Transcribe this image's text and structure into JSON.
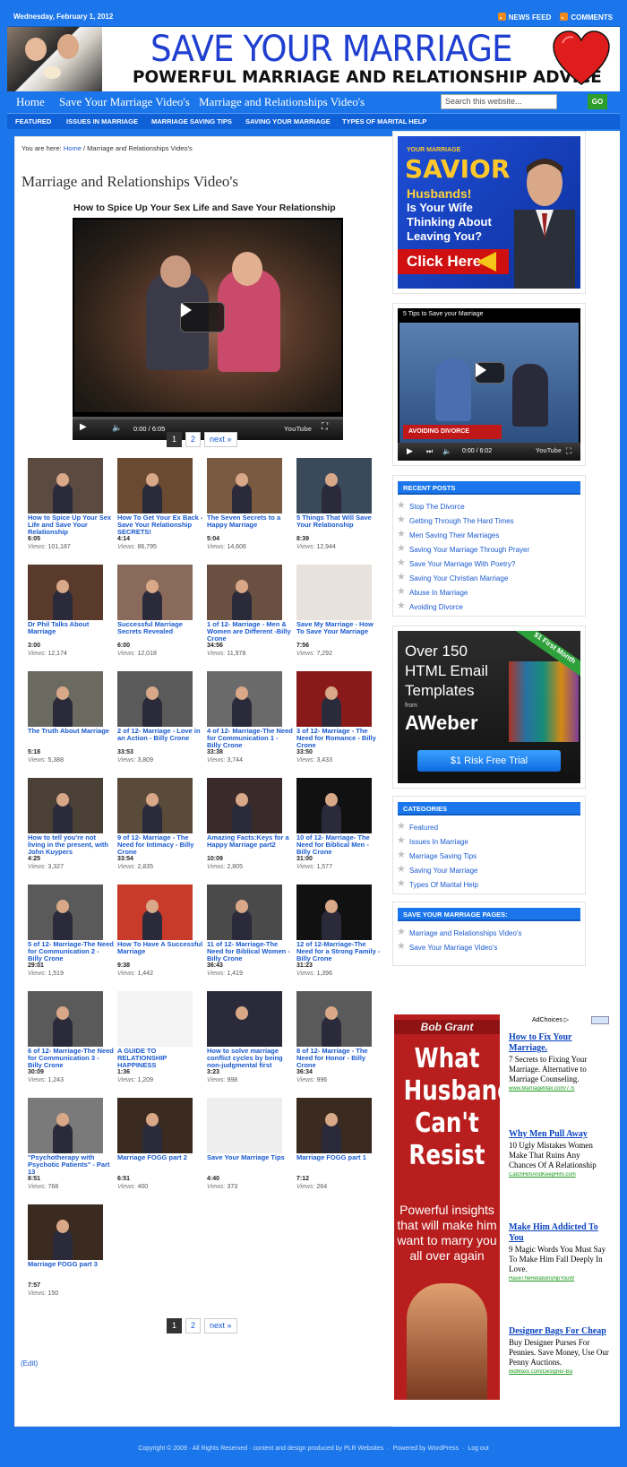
{
  "topbar": {
    "date": "Wednesday, February 1, 2012",
    "news_feed": "NEWS FEED",
    "comments": "COMMENTS"
  },
  "header": {
    "title": "SAVE YOUR MARRIAGE",
    "subtitle": "POWERFUL MARRIAGE AND RELATIONSHIP ADVICE"
  },
  "nav": {
    "primary": [
      "Home",
      "Save Your Marriage Video's",
      "Marriage and Relationships Video's"
    ],
    "search_placeholder": "Search this website...",
    "go": "GO",
    "secondary": [
      "FEATURED",
      "ISSUES IN MARRIAGE",
      "MARRIAGE SAVING TIPS",
      "SAVING YOUR MARRIAGE",
      "TYPES OF MARITAL HELP"
    ]
  },
  "breadcrumb": {
    "prefix": "You are here:",
    "home": "Home",
    "sep": "/",
    "current": "Marriage and Relationships Video's"
  },
  "page": {
    "title": "Marriage and Relationships Video's",
    "video_title": "How to Spice Up Your Sex Life and Save Your Relationship",
    "player_time": "0:00 / 6:05",
    "player_brand": "YouTube",
    "pager": [
      "1",
      "2",
      "next »"
    ],
    "views_label": "Views:",
    "edit": "(Edit)"
  },
  "videos": [
    {
      "title": "How to Spice Up Your Sex Life and Save Your Relationship",
      "dur": "6:05",
      "views": "101,187",
      "col": "#5a4a40"
    },
    {
      "title": "How To Get Your Ex Back - Save Your Relationship SECRETS!",
      "dur": "4:14",
      "views": "86,795",
      "col": "#6a4a30"
    },
    {
      "title": "The Seven Secrets to a Happy Marriage",
      "dur": "5:04",
      "views": "14,606",
      "col": "#7a5a40"
    },
    {
      "title": "5 Things That Will Save Your Relationship",
      "dur": "8:39",
      "views": "12,944",
      "col": "#3a4a5a"
    },
    {
      "title": "Dr Phil Talks About Marriage",
      "dur": "3:00",
      "views": "12,174",
      "col": "#5a3a2a"
    },
    {
      "title": "Successful Marriage Secrets Revealed",
      "dur": "6:00",
      "views": "12,018",
      "col": "#8a6a5a"
    },
    {
      "title": "1 of 12- Marriage - Men & Women are Different -Billy Crone",
      "dur": "34:56",
      "views": "11,978",
      "col": "#6a5040"
    },
    {
      "title": "Save My Marriage - How To Save Your Marriage",
      "dur": "7:56",
      "views": "7,292",
      "col": "#e8e2dc"
    },
    {
      "title": "The Truth About Marriage",
      "dur": "5:18",
      "views": "5,388",
      "col": "#6a6a60"
    },
    {
      "title": "2 of 12- Marriage - Love in an Action - Billy Crone",
      "dur": "33:53",
      "views": "3,809",
      "col": "#5a5a5a"
    },
    {
      "title": "4 of 12- Marriage-The Need for Communication 1 - Billy Crone",
      "dur": "33:38",
      "views": "3,744",
      "col": "#6a6a6a"
    },
    {
      "title": "3 of 12- Marriage - The Need for Romance - Billy Crone",
      "dur": "33:50",
      "views": "3,433",
      "col": "#8a1a1a"
    },
    {
      "title": "How to tell you're not living in the present, with John Kuypers",
      "dur": "4:25",
      "views": "3,327",
      "col": "#4a4036"
    },
    {
      "title": "9 of 12- Marriage - The Need for Intimacy - Billy Crone",
      "dur": "33:54",
      "views": "2,835",
      "col": "#5a4a3a"
    },
    {
      "title": "Amazing Facts:Keys for a Happy Marriage part2",
      "dur": "10:09",
      "views": "2,805",
      "col": "#3a2a2a"
    },
    {
      "title": "10 of 12- Marriage- The Need for Biblical Men - Billy Crone",
      "dur": "31:00",
      "views": "1,577",
      "col": "#111111"
    },
    {
      "title": "5 of 12- Marriage-The Need for Communication 2 - Billy Crone",
      "dur": "29:01",
      "views": "1,519",
      "col": "#5a5a5a"
    },
    {
      "title": "How To Have A Successful Marriage",
      "dur": "9:38",
      "views": "1,442",
      "col": "#c83a2a"
    },
    {
      "title": "11 of 12- Marriage-The Need for Biblical Women - Billy Crone",
      "dur": "36:43",
      "views": "1,419",
      "col": "#4a4a4a"
    },
    {
      "title": "12 of 12-Marriage-The Need for a Strong Family - Billy Crone",
      "dur": "31:23",
      "views": "1,396",
      "col": "#111111"
    },
    {
      "title": "6 of 12- Marriage-The Need for Communication 3 - Billy Crone",
      "dur": "30:09",
      "views": "1,243",
      "col": "#5a5a5a"
    },
    {
      "title": "A GUIDE TO RELATIONSHIP HAPPINESS",
      "dur": "1:36",
      "views": "1,209",
      "col": "#f4f4f4"
    },
    {
      "title": "How to solve marriage conflict cycles by being non-judgmental first",
      "dur": "3:23",
      "views": "998",
      "col": "#2a2a3a"
    },
    {
      "title": "8 of 12- Marriage - The Need for Honor - Billy Crone",
      "dur": "36:34",
      "views": "996",
      "col": "#5a5a5a"
    },
    {
      "title": "\"Psychotherapy with Psychotic Patients\" - Part 13",
      "dur": "8:51",
      "views": "768",
      "col": "#7a7a7a"
    },
    {
      "title": "Marriage FOGG part 2",
      "dur": "6:51",
      "views": "400",
      "col": "#3a2a20"
    },
    {
      "title": "Save Your Marriage Tips",
      "dur": "4:40",
      "views": "373",
      "col": "#eeeeee"
    },
    {
      "title": "Marriage FOGG part 1",
      "dur": "7:12",
      "views": "264",
      "col": "#3a2a20"
    },
    {
      "title": "Marriage FOGG part 3",
      "dur": "7:57",
      "views": "150",
      "col": "#3a2a20"
    }
  ],
  "sidebar": {
    "savior_ad": {
      "top": "YOUR MARRIAGE",
      "brand": "SAVIOR",
      "line1": "Husbands!",
      "line2": "Is Your Wife Thinking About Leaving You?",
      "cta": "Click Here"
    },
    "video": {
      "title": "5 Tips to Save your Marriage",
      "lower_third": "AVOIDING DIVORCE",
      "time": "0:00 / 6:02"
    },
    "recent_posts_title": "RECENT POSTS",
    "recent_posts": [
      "Stop The Divorce",
      "Getting Through The Hard Times",
      "Men Saving Their Marriages",
      "Saving Your Marriage Through Prayer",
      "Save Your Marriage With Poetry?",
      "Saving Your Christian Marriage",
      "Abuse In Marriage",
      "Avoiding Divorce"
    ],
    "aweber": {
      "line1": "Over 150",
      "line2": "HTML Email",
      "line3": "Templates",
      "from": "from",
      "brand": "AWeber",
      "cta": "$1 Risk Free Trial",
      "ribbon": "$1 First Month"
    },
    "categories_title": "CATEGORIES",
    "categories": [
      "Featured",
      "Issues In Marriage",
      "Marriage Saving Tips",
      "Saving Your Marriage",
      "Types Of Marital Help"
    ],
    "pages_title": "SAVE YOUR MARRIAGE PAGES:",
    "pages": [
      "Marriage and Relationships Video's",
      "Save Your Marriage Video's"
    ],
    "bob": {
      "name": "Bob Grant",
      "headline": "What Husbands Can't Resist",
      "sub": "Powerful insights that will make him want to marry you all over again"
    },
    "adchoices": "AdChoices",
    "ads": [
      {
        "h": "How to Fix Your Marriage.",
        "b": "7 Secrets to Fixing Your Marriage. Alternative to Marriage Counseling.",
        "u": "www.MarriageMax.com/7-S"
      },
      {
        "h": "Why Men Pull Away",
        "b": "10 Ugly Mistakes Women Make That Ruins Any Chances Of A Relationship",
        "u": "CatchHimAndKeepHim.com"
      },
      {
        "h": "Make Him Addicted To You",
        "b": "9 Magic Words You Must Say To Make Him Fall Deeply In Love.",
        "u": "HaveTheRelationshipYouW"
      },
      {
        "h": "Designer Bags For Cheap",
        "b": "Buy Designer Purses For Pennies. Save Money, Use Our Penny Auctions.",
        "u": "BidMaxx.com/Designer-Ba"
      }
    ]
  },
  "footer": {
    "copyright": "Copyright © 2009 · All Rights Reserved · content and design produced by PLR Websites",
    "powered": "Powered by WordPress",
    "logout": "Log out"
  }
}
